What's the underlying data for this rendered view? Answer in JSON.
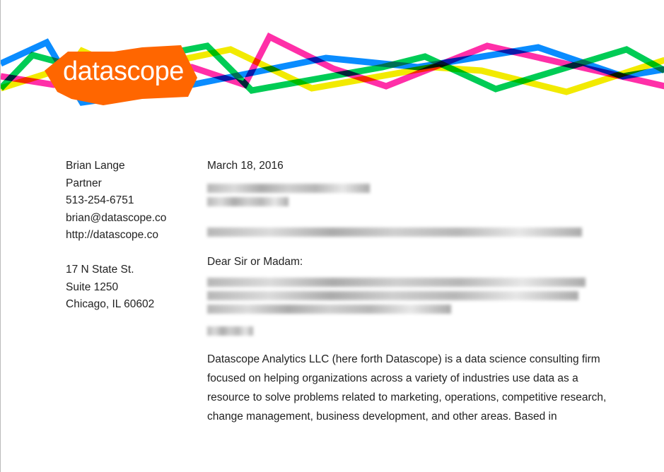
{
  "logo": {
    "text": "datascope",
    "color": "#ff6600"
  },
  "banner_colors": {
    "blue": "#0a8cff",
    "green": "#00cc55",
    "yellow": "#f2ea00",
    "pink": "#ff2fa8"
  },
  "sender": {
    "name": "Brian Lange",
    "title": "Partner",
    "phone": "513-254-6751",
    "email": "brian@datascope.co",
    "website": "http://datascope.co",
    "address1": "17 N State St.",
    "address2": "Suite 1250",
    "address3": "Chicago, IL 60602"
  },
  "letter": {
    "date": "March 18, 2016",
    "salutation": "Dear Sir or Madam:",
    "body": "Datascope Analytics LLC (here forth Datascope) is a data science consulting firm focused on helping organizations across a variety of industries use data as a resource to solve problems related to marketing, operations, competitive research, change management, business development, and other areas. Based in"
  }
}
